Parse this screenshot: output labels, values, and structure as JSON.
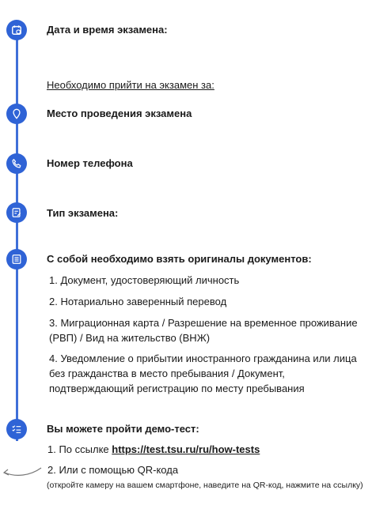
{
  "steps": {
    "date_title": "Дата и время экзамена:",
    "arrive_note": "Необходимо прийти на экзамен за:",
    "place_title": "Место проведения экзамена",
    "phone_title": "Номер телефона",
    "type_title": "Тип экзамена:",
    "docs_title": "С собой необходимо взять оригиналы документов:",
    "demo_title": "Вы можете пройти демо-тест:"
  },
  "docs": [
    "1. Документ, удостоверяющий личность",
    "2. Нотариально заверенный перевод",
    "3. Миграционная карта / Разрешение на временное проживание (РВП) /  Вид на жительство (ВНЖ)",
    "4. Уведомление о прибытии иностранного гражданина или лица без гражданства в место пребывания / Документ, подтверждающий регистрацию по месту пребывания"
  ],
  "demo": {
    "item1_prefix": "1. По ссылке ",
    "item1_link": "https://test.tsu.ru/ru/how-tests",
    "item2": "2. Или с помощью QR-кода",
    "item2_note": "(откройте камеру на вашем смартфоне, наведите на QR-код, нажмите на ссылку)"
  },
  "icons": [
    "calendar-icon",
    "location-pin-icon",
    "phone-icon",
    "edit-document-icon",
    "document-list-icon",
    "checklist-icon",
    "curved-arrow-icon"
  ],
  "colors": {
    "accent": "#2f63d6",
    "line": "#3f6fd8",
    "text": "#1a1a1a"
  }
}
